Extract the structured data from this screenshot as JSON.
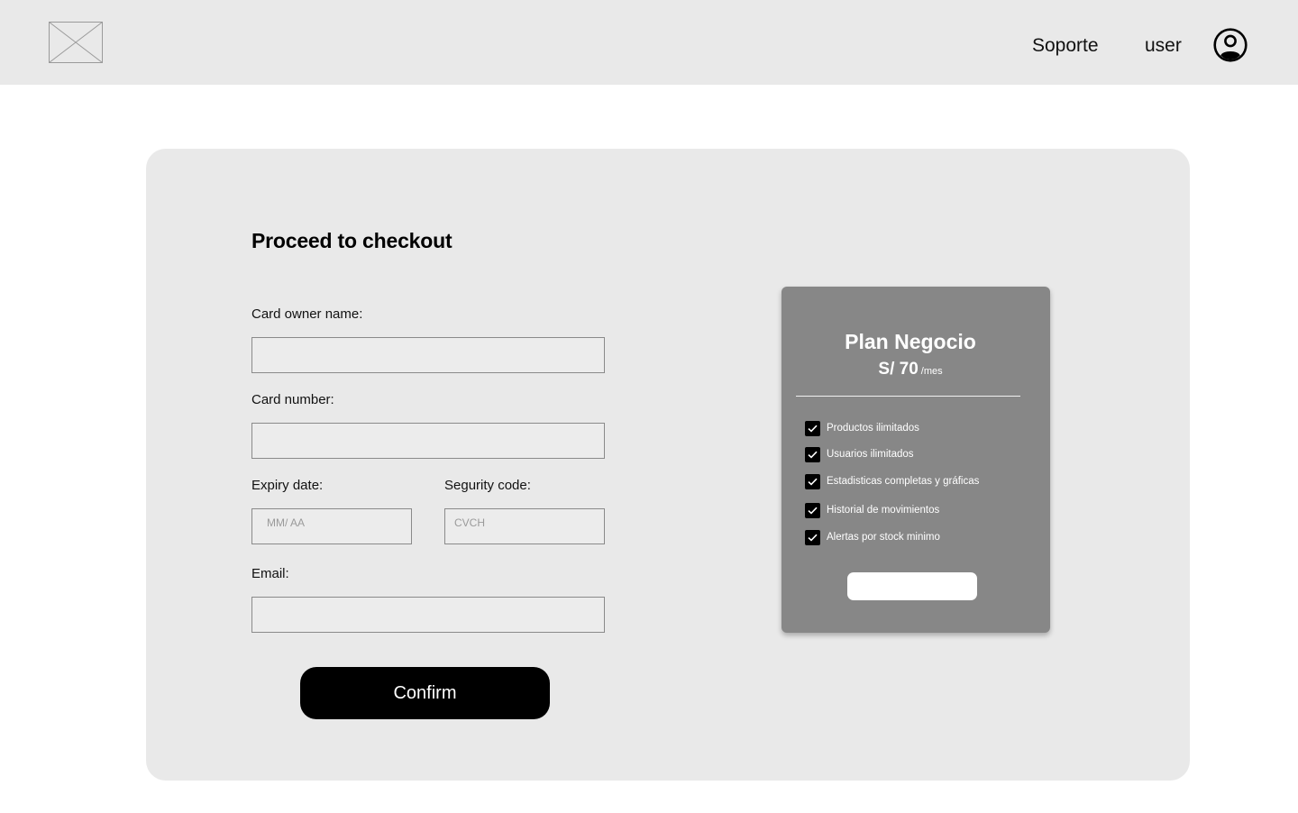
{
  "header": {
    "logo_icon": "image-placeholder-icon",
    "nav": {
      "soporte": "Soporte",
      "user": "user"
    },
    "avatar_icon": "user-circle-icon"
  },
  "checkout": {
    "title": "Proceed to checkout",
    "fields": {
      "owner": {
        "label": "Card owner name:",
        "value": "",
        "placeholder": ""
      },
      "number": {
        "label": "Card number:",
        "value": "",
        "placeholder": ""
      },
      "expiry": {
        "label": "Expiry date:",
        "value": "",
        "placeholder": "MM/ AA"
      },
      "code": {
        "label": "Segurity code:",
        "value": "",
        "placeholder": "CVCH"
      },
      "email": {
        "label": "Email:",
        "value": "",
        "placeholder": ""
      }
    },
    "confirm_label": "Confirm"
  },
  "plan": {
    "name": "Plan Negocio",
    "price": "S/ 70",
    "period": "/mes",
    "check_icon": "checkbox-checked-icon",
    "features": [
      "Productos ilimitados",
      "Usuarios ilimitados",
      "Estadisticas completas y gráficas",
      "Historial de movimientos",
      "Alertas por stock minimo"
    ],
    "button_label": ""
  },
  "colors": {
    "header_bg": "#e9e9e9",
    "card_bg": "#e9e9e9",
    "plan_bg": "#878787",
    "button_bg": "#000000"
  }
}
